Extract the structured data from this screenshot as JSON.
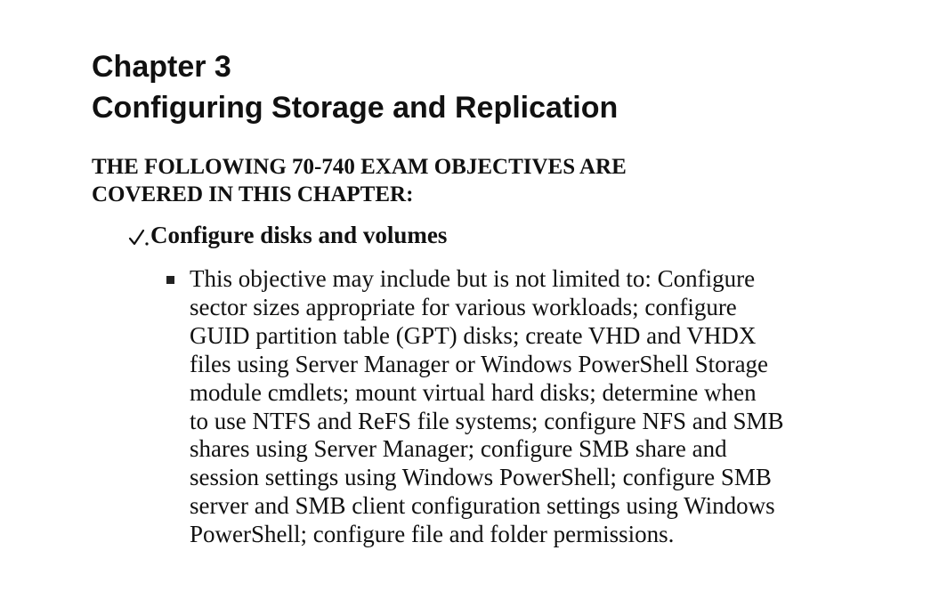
{
  "chapter": {
    "number_line": "Chapter 3",
    "title_line": "Configuring Storage and Replication"
  },
  "objectives_heading": {
    "lines": [
      "THE FOLLOWING 70-740 EXAM OBJECTIVES ARE",
      "COVERED IN THIS CHAPTER:"
    ]
  },
  "objective": {
    "icon": "check-icon",
    "title": "Configure disks and volumes",
    "bullet_lines": [
      "This objective may include but is not limited to: Configure",
      "sector sizes appropriate for various workloads; configure",
      "GUID partition table (GPT) disks; create VHD and VHDX",
      "files using Server Manager or Windows PowerShell Storage",
      "module cmdlets; mount virtual hard disks; determine when",
      "to use NTFS and ReFS file systems; configure NFS and SMB",
      "shares using Server Manager; configure SMB share and",
      "session settings using Windows PowerShell; configure SMB",
      "server and SMB client configuration settings using Windows",
      "PowerShell; configure file and folder permissions."
    ]
  }
}
